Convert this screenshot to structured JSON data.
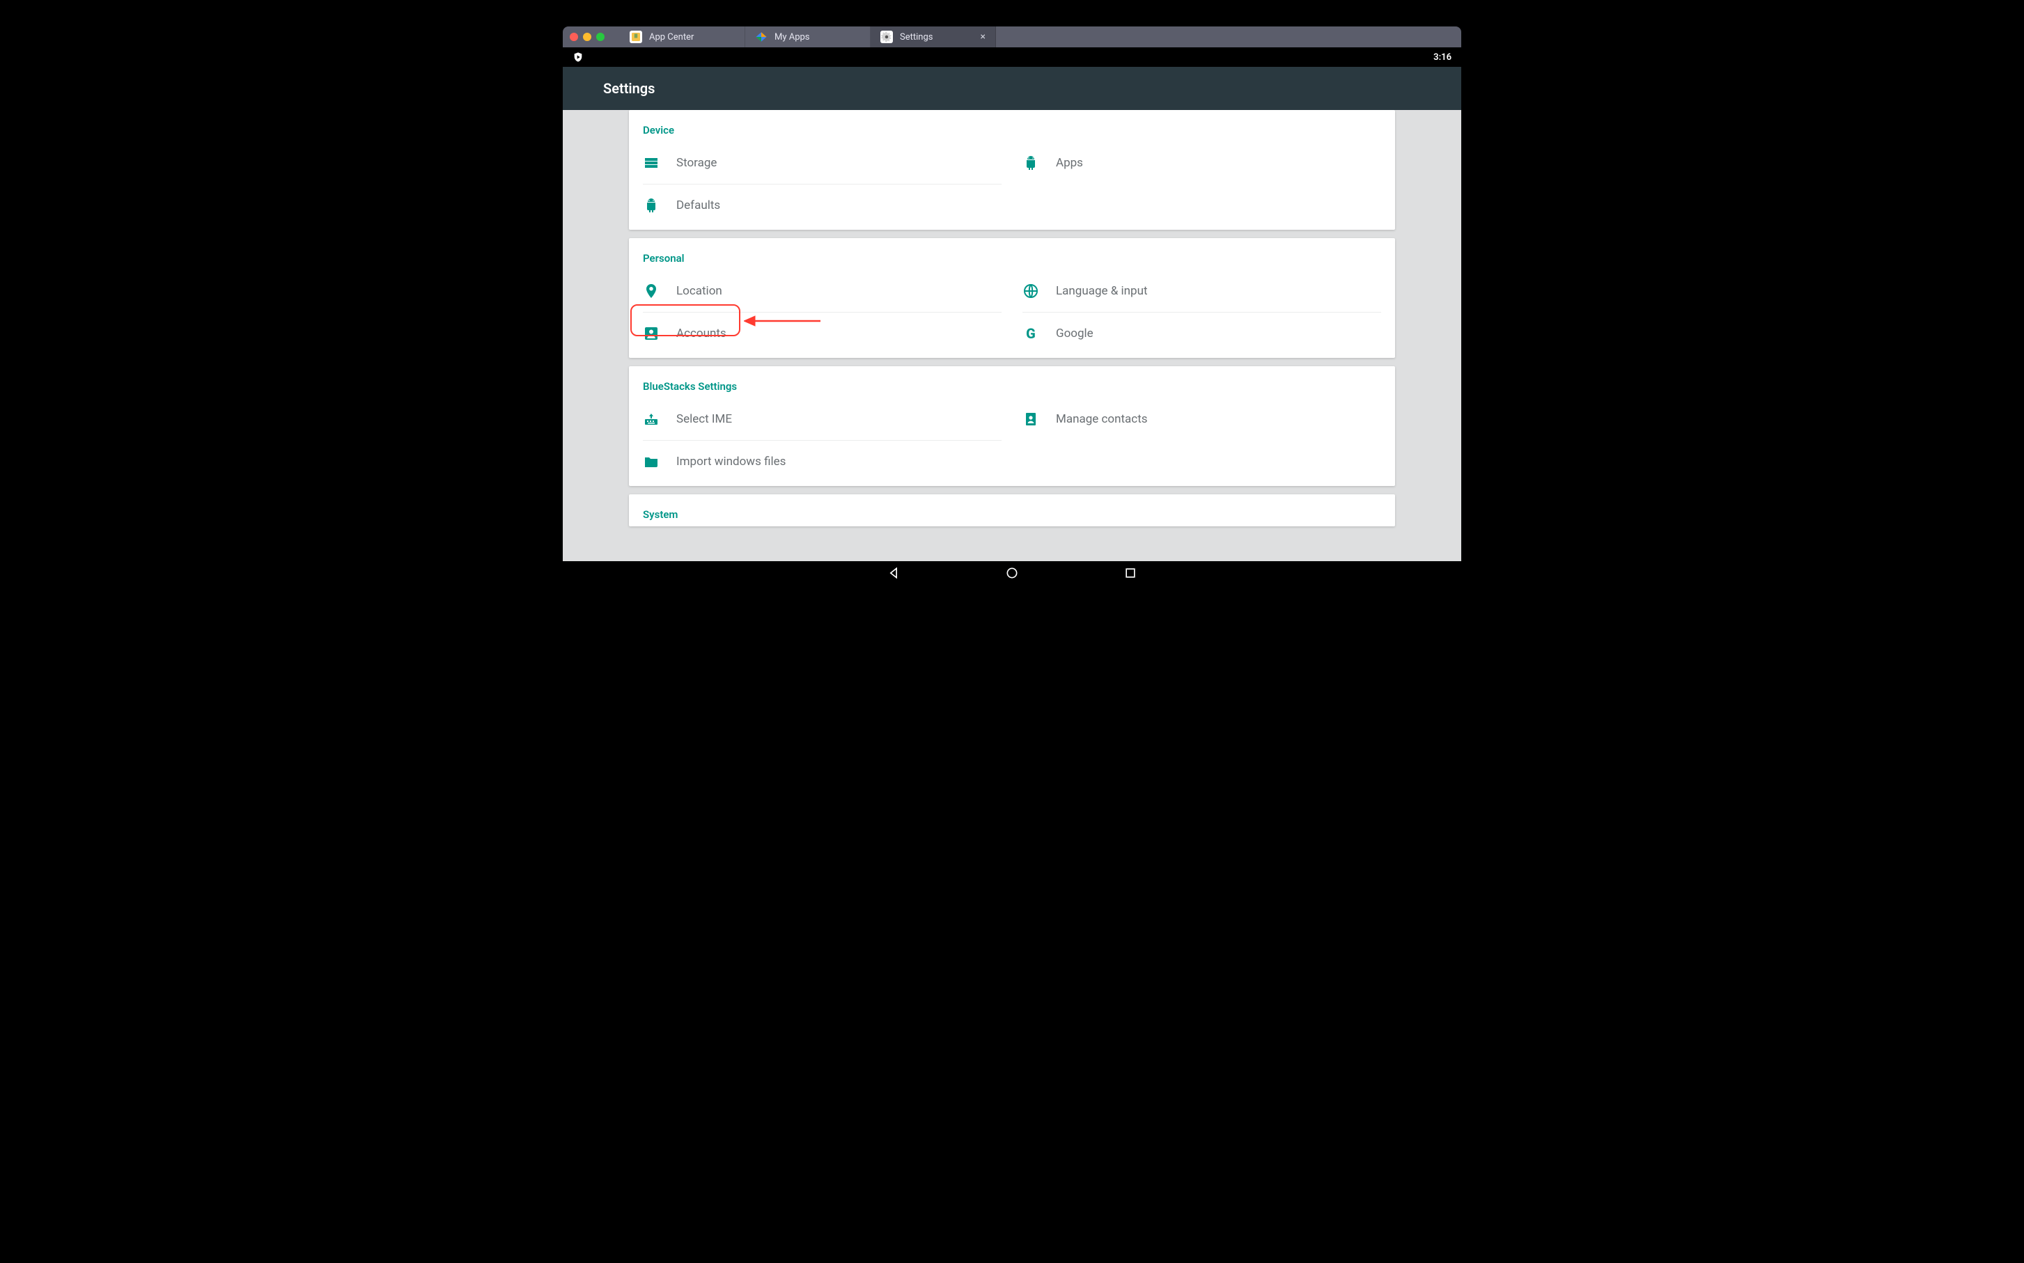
{
  "tabs": {
    "app_center": "App Center",
    "my_apps": "My Apps",
    "settings": "Settings"
  },
  "status": {
    "time": "3:16"
  },
  "header": {
    "title": "Settings"
  },
  "sections": {
    "device": {
      "title": "Device",
      "storage": "Storage",
      "apps": "Apps",
      "defaults": "Defaults"
    },
    "personal": {
      "title": "Personal",
      "location": "Location",
      "language": "Language & input",
      "accounts": "Accounts",
      "google": "Google"
    },
    "bluestacks": {
      "title": "BlueStacks Settings",
      "ime": "Select IME",
      "contacts": "Manage contacts",
      "import": "Import windows files"
    },
    "system": {
      "title": "System"
    }
  }
}
